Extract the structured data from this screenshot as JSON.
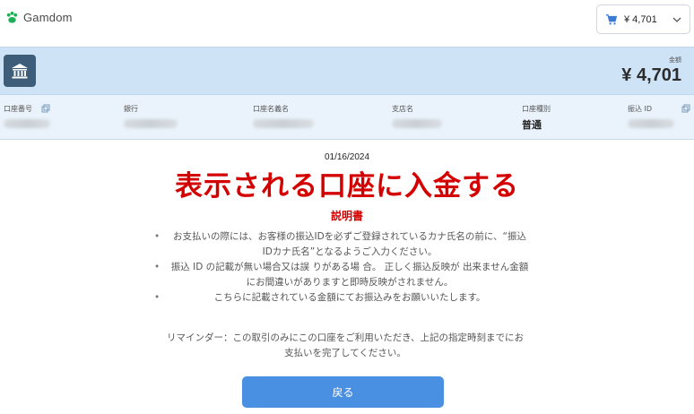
{
  "header": {
    "brand": "Gamdom",
    "wallet_amount": "¥ 4,701"
  },
  "banner": {
    "amount_label": "金額",
    "amount_value": "¥ 4,701"
  },
  "details": {
    "account_number_label": "口座番号",
    "bank_label": "銀行",
    "account_holder_label": "口座名義名",
    "branch_label": "支店名",
    "account_type_label": "口座種別",
    "account_type_value": "普通",
    "transfer_id_label": "振込 ID"
  },
  "main": {
    "date": "01/16/2024",
    "headline": "表示される口座に入金する",
    "instructions_title": "説明書",
    "bullets": [
      "お支払いの際には、お客様の振込IDを必ずご登録されているカナ氏名の前に、“振込IDカナ氏名”となるようご入力ください。",
      "振込 ID の記載が無い場合又は誤 りがある場 合。 正しく振込反映が 出来ません金額にお間違いがありますと即時反映がされません。",
      "こちらに記載されている金額にてお振込みをお願いいたします。"
    ],
    "reminder": "リマインダー：この取引のみにこの口座をご利用いただき、上記の指定時刻までにお支払いを完了してください。",
    "back_button": "戻る"
  },
  "colors": {
    "banner_bg": "#cfe3f7",
    "details_bg": "#eaf3fb",
    "headline_red": "#d40000",
    "button_blue": "#4a90e2",
    "bank_icon_bg": "#3e5d78"
  }
}
